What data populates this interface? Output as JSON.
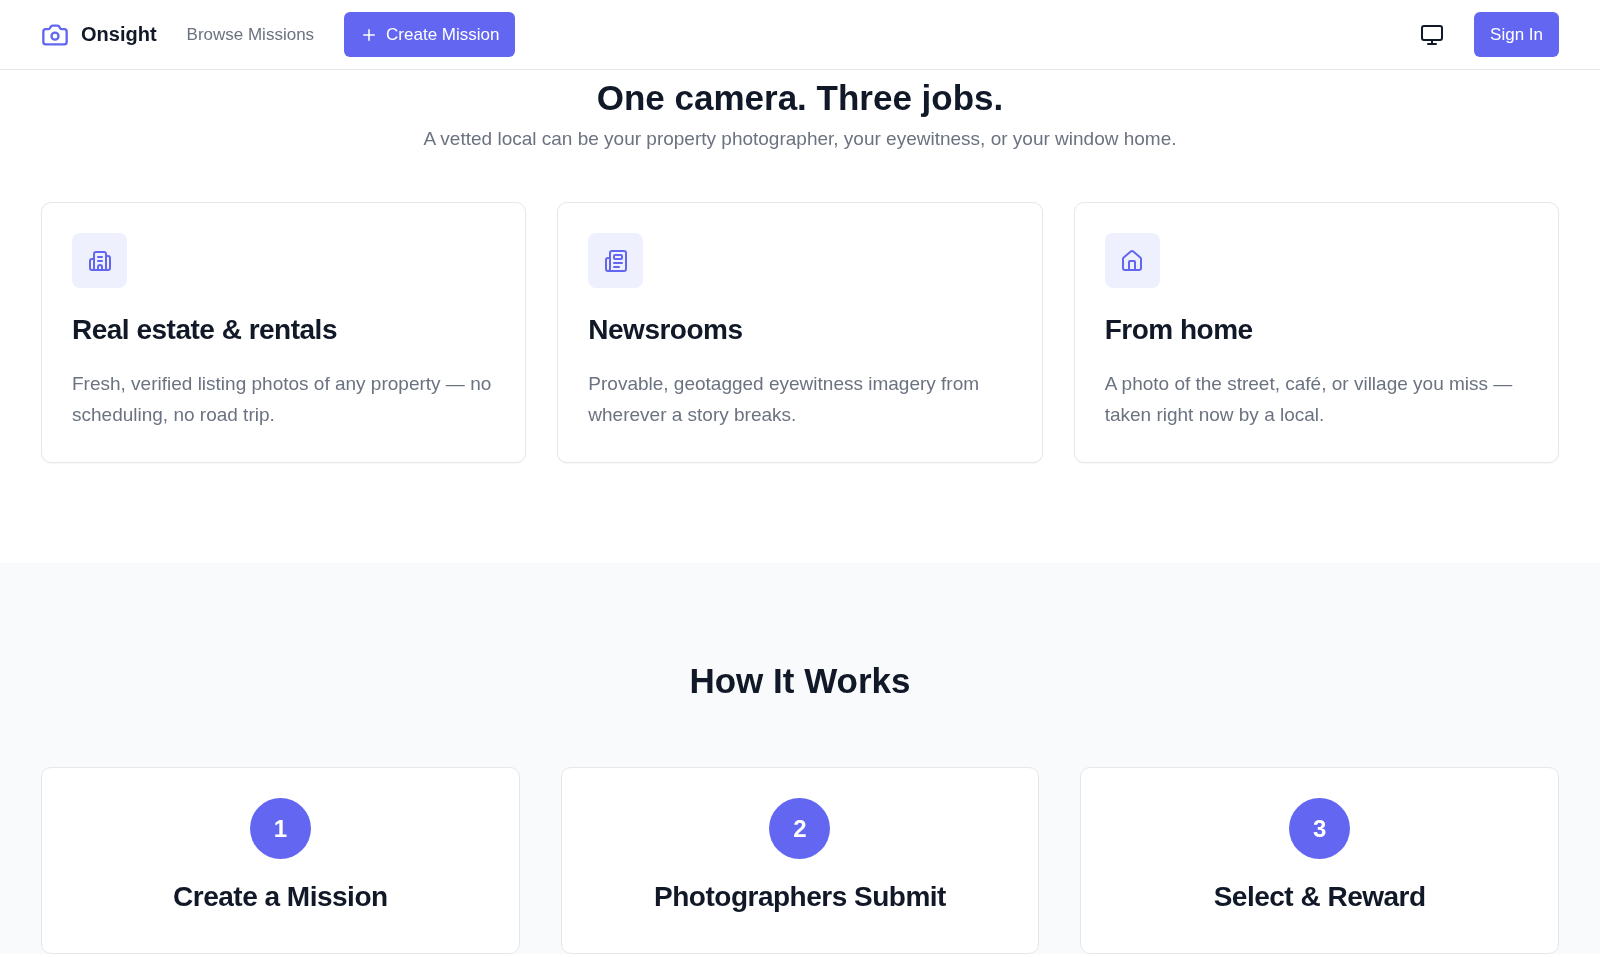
{
  "header": {
    "brand": "Onsight",
    "nav": [
      {
        "label": "Browse Missions",
        "kind": "link"
      },
      {
        "label": "Create Mission",
        "kind": "primary"
      }
    ],
    "sign_in": "Sign In"
  },
  "uses": {
    "title": "One camera. Three jobs.",
    "subtitle": "A vetted local can be your property photographer, your eyewitness, or your window home.",
    "cards": [
      {
        "kind": "building",
        "title": "Real estate & rentals",
        "text": "Fresh, verified listing photos of any property — no scheduling, no road trip."
      },
      {
        "kind": "news",
        "title": "Newsrooms",
        "text": "Provable, geotagged eyewitness imagery from wherever a story breaks."
      },
      {
        "kind": "home",
        "title": "From home",
        "text": "A photo of the street, café, or village you miss — taken right now by a local."
      }
    ]
  },
  "how": {
    "title": "How It Works",
    "steps": [
      {
        "number": "1",
        "title": "Create a Mission"
      },
      {
        "number": "2",
        "title": "Photographers Submit"
      },
      {
        "number": "3",
        "title": "Select & Reward"
      }
    ]
  }
}
